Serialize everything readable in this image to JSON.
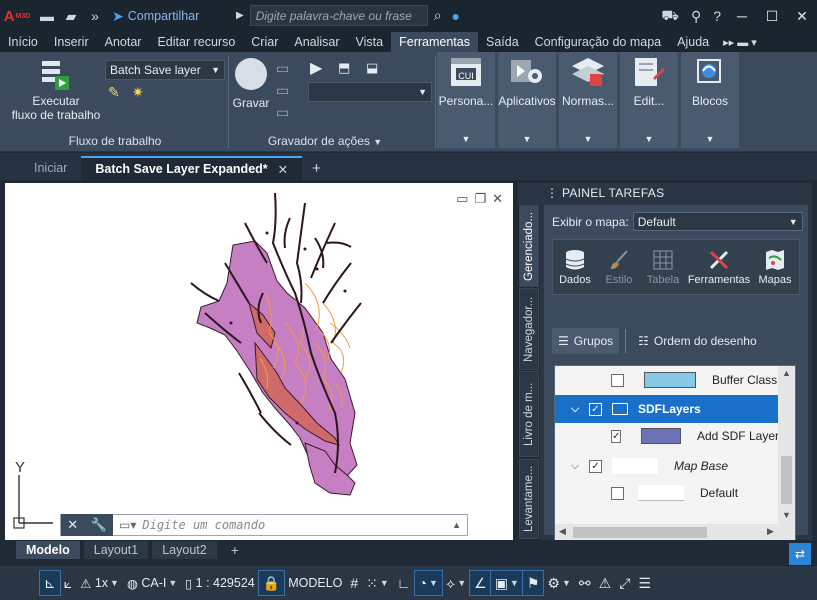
{
  "app": {
    "logo": "A",
    "logo_suffix": "M3D",
    "share_label": "Compartilhar",
    "search_placeholder": "Digite palavra-chave ou frase"
  },
  "menu_tabs": [
    "Início",
    "Inserir",
    "Anotar",
    "Editar recurso",
    "Criar",
    "Analisar",
    "Vista",
    "Ferramentas",
    "Saída",
    "Configuração do mapa",
    "Ajuda"
  ],
  "active_menu_tab": "Ferramentas",
  "ribbon": {
    "run_workflow_label": "Executar\nfluxo de trabalho",
    "workflow_select": "Batch Save layer",
    "workflow_panel": "Fluxo de trabalho",
    "play_label": "Gravar",
    "recorder_panel": "Gravador de ações",
    "tiles": [
      {
        "label": "Persona...",
        "icon": "cui-icon",
        "icon_text": "CUI"
      },
      {
        "label": "Aplicativos",
        "icon": "applications-icon"
      },
      {
        "label": "Normas...",
        "icon": "standards-icon"
      },
      {
        "label": "Edit...",
        "icon": "edit-icon"
      },
      {
        "label": "Blocos",
        "icon": "blocks-icon"
      }
    ]
  },
  "doc_tabs": {
    "start": "Iniciar",
    "active": "Batch Save Layer Expanded*"
  },
  "command": {
    "placeholder": "Digite um comando"
  },
  "ucs": {
    "y_label": "Y"
  },
  "task_pane": {
    "title": "PAINEL TAREFAS",
    "vertical_tabs": [
      "Gerenciado...",
      "Navegador...",
      "Livro de m...",
      "Levantame..."
    ],
    "map_label": "Exibir o mapa:",
    "map_value": "Default",
    "tools": [
      {
        "label": "Dados",
        "icon": "database-icon",
        "enabled": true
      },
      {
        "label": "Estilo",
        "icon": "brush-icon",
        "enabled": false
      },
      {
        "label": "Tabela",
        "icon": "table-icon",
        "enabled": false
      },
      {
        "label": "Ferramentas",
        "icon": "tools-icon",
        "enabled": true
      },
      {
        "label": "Mapas",
        "icon": "maps-icon",
        "enabled": true
      }
    ],
    "groups_label": "Grupos",
    "draw_order_label": "Ordem do desenho",
    "layers": [
      {
        "name": "Buffer Class",
        "checked": false,
        "swatch": "#87c9e8",
        "indent": 1
      },
      {
        "name": "SDFLayers",
        "checked": true,
        "folder": true,
        "selected": true,
        "indent": 0
      },
      {
        "name": "Add SDF Layer",
        "checked": true,
        "swatch": "#6b72b6",
        "indent": 1
      },
      {
        "name": "Map Base",
        "checked": true,
        "italic": true,
        "indent": 0
      },
      {
        "name": "Default",
        "checked": false,
        "line": true,
        "indent": 1
      }
    ]
  },
  "layout_tabs": [
    "Modelo",
    "Layout1",
    "Layout2"
  ],
  "active_layout": "Modelo",
  "status": {
    "scale_factor": "1x",
    "coord_system": "CA-I",
    "map_scale": "1 : 429524",
    "model_label": "MODELO"
  },
  "colors": {
    "accent": "#1a6fc8",
    "ribbon": "#3b4a5c",
    "title": "#1b2530",
    "map_fill": "#c77fc4",
    "map_accent": "#f39a3a"
  }
}
